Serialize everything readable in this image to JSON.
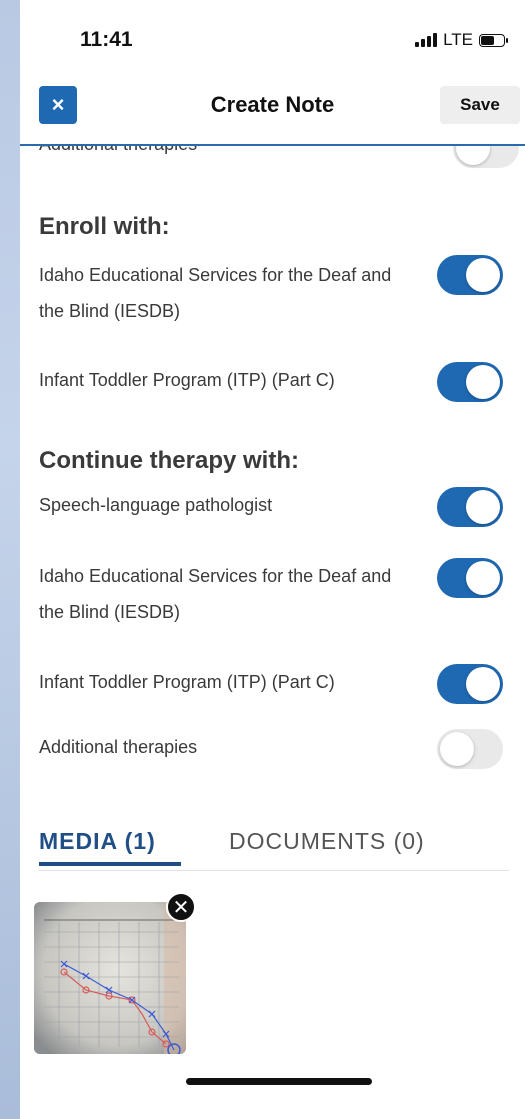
{
  "status_bar": {
    "time": "11:41",
    "network": "LTE"
  },
  "nav": {
    "close_label": "×",
    "title": "Create Note",
    "save_label": "Save"
  },
  "partial_row": {
    "label": "Additional therapies",
    "toggle": "off"
  },
  "enroll": {
    "heading": "Enroll with:",
    "items": [
      {
        "label_line1": "Idaho Educational Services for the Deaf and",
        "label_line2": "the Blind (IESDB)",
        "toggle": "on"
      },
      {
        "label_line1": "Infant Toddler Program (ITP) (Part C)",
        "toggle": "on"
      }
    ]
  },
  "continue": {
    "heading": "Continue therapy with:",
    "items": [
      {
        "label_line1": "Speech-language pathologist",
        "toggle": "on"
      },
      {
        "label_line1": "Idaho Educational Services for the Deaf and",
        "label_line2": "the Blind (IESDB)",
        "toggle": "on"
      },
      {
        "label_line1": "Infant Toddler Program (ITP) (Part C)",
        "toggle": "on"
      },
      {
        "label_line1": "Additional therapies",
        "toggle": "off"
      }
    ]
  },
  "tabs": {
    "media_label": "MEDIA (1)",
    "documents_label": "DOCUMENTS (0)"
  },
  "media": {
    "thumbnail_icon": "audiogram-photo",
    "remove_icon": "close-circle-icon"
  },
  "colors": {
    "accent": "#1f69b3",
    "toggle_off": "#e9e9ea",
    "tab_active": "#1f4f86"
  }
}
